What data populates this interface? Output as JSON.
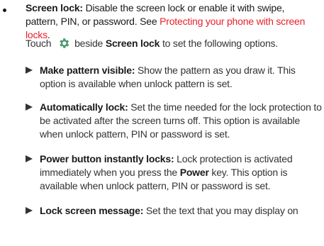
{
  "bullet": {
    "title": "Screen lock:",
    "text": " Disable the screen lock or enable it with swipe, pattern, PIN, or password. See ",
    "link": "Protecting your phone with screen locks",
    "end": "."
  },
  "touch_line": {
    "prefix": "Touch",
    "icon": "gear-icon",
    "middle": "beside",
    "target": "Screen lock",
    "suffix": "to set the following options."
  },
  "options": [
    {
      "title": "Make pattern visible:",
      "text": " Show the pattern as you draw it. This option is available when unlock pattern is set."
    },
    {
      "title": "Automatically lock:",
      "text": " Set the time needed for the lock protection to be activated after the screen turns off. This option is available when unlock pattern, PIN or password is set."
    },
    {
      "title": "Power button instantly locks:",
      "text_before": " Lock protection is activated immediately when you press the ",
      "bold_word": "Power",
      "text_after": " key. This option is available when unlock pattern, PIN or password is set."
    },
    {
      "title": "Lock screen message:",
      "text": " Set the text that you may display on"
    }
  ],
  "colors": {
    "link": "#e8202a",
    "gear": "#4a9a72"
  }
}
